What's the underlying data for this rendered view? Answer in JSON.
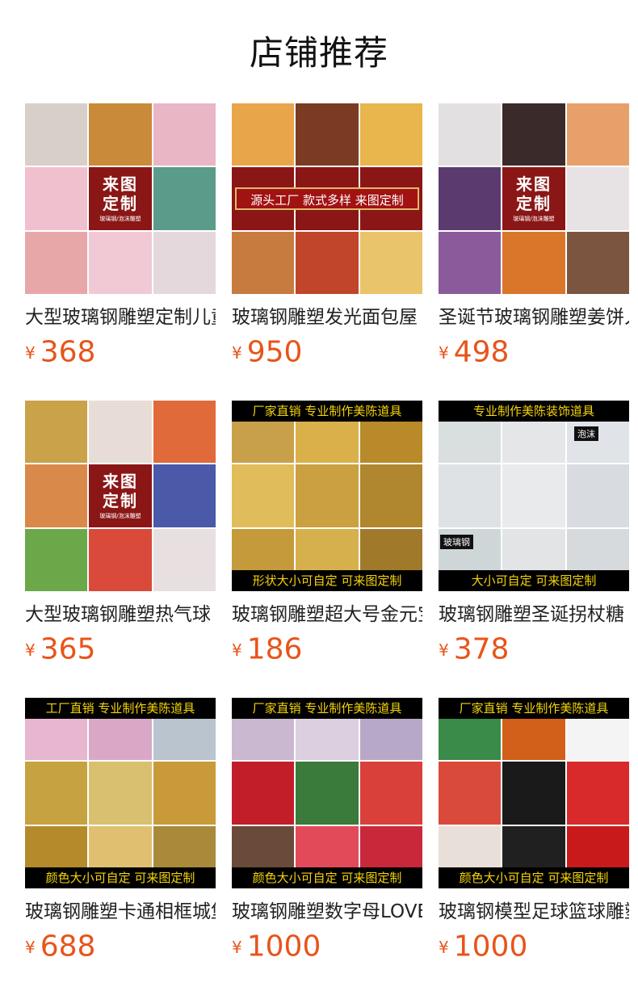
{
  "header": {
    "title": "店铺推荐"
  },
  "currency": "¥",
  "colors": {
    "price": "#e8541a",
    "badge": "#8b1616",
    "strip_bg": "#000000",
    "strip_text": "#f5d40a"
  },
  "products": [
    {
      "name": "大型玻璃钢雕塑定制儿童乐园",
      "price": "368",
      "badge": {
        "line1": "来图",
        "line2": "定制",
        "sub": "玻璃钢/泡沫雕塑"
      },
      "cells": [
        "#d8cfc9",
        "#c98a3a",
        "#e9b6c6",
        "#f1c0cf",
        "#8b1616",
        "#5a9b8a",
        "#e7a7a9",
        "#f0c9d4",
        "#e4d8dc"
      ]
    },
    {
      "name": "玻璃钢雕塑发光面包屋",
      "price": "950",
      "band": "源头工厂  款式多样  来图定制",
      "cells": [
        "#e9a54a",
        "#7a3b22",
        "#e8b64d",
        "#8b1616",
        "#8b1616",
        "#8b1616",
        "#c77b3f",
        "#c1452b",
        "#e9c46a"
      ]
    },
    {
      "name": "圣诞节玻璃钢雕塑姜饼人",
      "price": "498",
      "badge": {
        "line1": "来图",
        "line2": "定制",
        "sub": "玻璃钢/泡沫雕塑"
      },
      "cells": [
        "#e3e0e2",
        "#3b2a2a",
        "#e8a06a",
        "#5b3b6f",
        "#8b1616",
        "#e7e3e4",
        "#8a5a9b",
        "#d9762a",
        "#7b5540"
      ]
    },
    {
      "name": "大型玻璃钢雕塑热气球",
      "price": "365",
      "badge": {
        "line1": "来图",
        "line2": "定制",
        "sub": "玻璃钢/泡沫雕塑"
      },
      "cells": [
        "#c9a24a",
        "#e8dcd7",
        "#e06a3a",
        "#d98a4a",
        "#8b1616",
        "#4a5aa8",
        "#6aa84a",
        "#d94a3a",
        "#e8e0e0"
      ]
    },
    {
      "name": "玻璃钢雕塑超大号金元宝",
      "price": "186",
      "strip_top": "厂家直销  专业制作美陈道具",
      "strip_bottom": "形状大小可自定  可来图定制",
      "cells": [
        "#c9a04a",
        "#d9b04a",
        "#b88a2a",
        "#e0bc5a",
        "#caa040",
        "#b0862e",
        "#c49a3a",
        "#d6b04c",
        "#a07a2a"
      ]
    },
    {
      "name": "玻璃钢雕塑圣诞拐杖糖",
      "price": "378",
      "strip_top": "专业制作美陈装饰道具",
      "strip_bottom": "大小可自定  可来图定制",
      "label_left": "玻璃钢",
      "label_right": "泡沫",
      "cells": [
        "#d9dedf",
        "#e4e6e8",
        "#e0e4e8",
        "#dfe2e4",
        "#e9eaec",
        "#d8dce0",
        "#cfd6d8",
        "#e2e4e6",
        "#d6dadc"
      ]
    },
    {
      "name": "玻璃钢雕塑卡通相框城堡门头",
      "price": "688",
      "strip_top": "工厂直销  专业制作美陈道具",
      "strip_bottom": "颜色大小可自定  可来图定制",
      "cells": [
        "#e7b7d0",
        "#d9a8c6",
        "#b9c4cf",
        "#c7a240",
        "#d8c070",
        "#c99a3a",
        "#b58a2a",
        "#e0c070",
        "#a88a3a"
      ]
    },
    {
      "name": "玻璃钢雕塑数字母LOVE",
      "price": "1000",
      "strip_top": "厂家直销  专业制作美陈道具",
      "strip_bottom": "颜色大小可自定  可来图定制",
      "cells": [
        "#c9b8d0",
        "#dcd0e0",
        "#b8a8c8",
        "#c21e2a",
        "#3a7a3a",
        "#d9403a",
        "#6a4a3a",
        "#e24a5a",
        "#c8283a"
      ]
    },
    {
      "name": "玻璃钢模型足球篮球雕塑",
      "price": "1000",
      "strip_top": "厂家直销  专业制作美陈道具",
      "strip_bottom": "颜色大小可自定  可来图定制",
      "cells": [
        "#3a8a4a",
        "#d2601a",
        "#f4f4f4",
        "#d94a3a",
        "#1a1a1a",
        "#d82a2a",
        "#e8e0d8",
        "#202020",
        "#c81a1a"
      ]
    }
  ]
}
